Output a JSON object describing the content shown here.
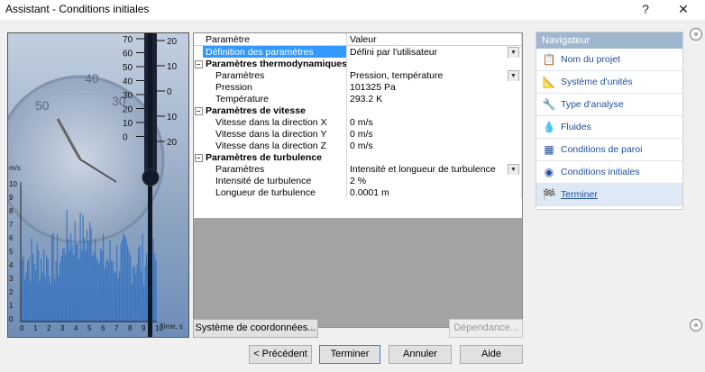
{
  "window": {
    "title": "Assistant - Conditions initiales",
    "help_label": "?",
    "close_label": "✕"
  },
  "illustration": {
    "left_scale": [
      "70",
      "60",
      "50",
      "40",
      "30",
      "20",
      "10",
      "0"
    ],
    "right_scale": [
      "20",
      "10",
      "0",
      "10",
      "20"
    ],
    "chart_y_labels": [
      "10",
      "9",
      "8",
      "7",
      "6",
      "5",
      "4",
      "3",
      "2",
      "1",
      "0"
    ],
    "chart_x_labels": [
      "0",
      "1",
      "2",
      "3",
      "4",
      "5",
      "6",
      "7",
      "8",
      "9",
      "10"
    ],
    "chart_y_unit": "m/s",
    "chart_x_unit": "Time, s",
    "gauge_numbers": [
      "50",
      "40",
      "30"
    ]
  },
  "table": {
    "header": {
      "param": "Paramètre",
      "value": "Valeur"
    },
    "rows": [
      {
        "kind": "sel",
        "indent": false,
        "expander": "",
        "label": "Définition des paramètres",
        "value": "Défini par l'utilisateur",
        "dropdown": true
      },
      {
        "kind": "sec",
        "indent": false,
        "expander": "−",
        "label": "Paramètres thermodynamiques",
        "value": "",
        "dropdown": false
      },
      {
        "kind": "row",
        "indent": true,
        "expander": "",
        "label": "Paramètres",
        "value": "Pression, température",
        "dropdown": true
      },
      {
        "kind": "row",
        "indent": true,
        "expander": "",
        "label": "Pression",
        "value": "101325 Pa",
        "dropdown": false
      },
      {
        "kind": "row",
        "indent": true,
        "expander": "",
        "label": "Température",
        "value": "293.2 K",
        "dropdown": false
      },
      {
        "kind": "sec",
        "indent": false,
        "expander": "−",
        "label": "Paramètres de vitesse",
        "value": "",
        "dropdown": false
      },
      {
        "kind": "row",
        "indent": true,
        "expander": "",
        "label": "Vitesse dans la direction X",
        "value": "0 m/s",
        "dropdown": false
      },
      {
        "kind": "row",
        "indent": true,
        "expander": "",
        "label": "Vitesse dans la direction Y",
        "value": "0 m/s",
        "dropdown": false
      },
      {
        "kind": "row",
        "indent": true,
        "expander": "",
        "label": "Vitesse dans la direction Z",
        "value": "0 m/s",
        "dropdown": false
      },
      {
        "kind": "sec",
        "indent": false,
        "expander": "−",
        "label": "Paramètres de turbulence",
        "value": "",
        "dropdown": false
      },
      {
        "kind": "row",
        "indent": true,
        "expander": "",
        "label": "Paramètres",
        "value": "Intensité et longueur de turbulence",
        "dropdown": true
      },
      {
        "kind": "row",
        "indent": true,
        "expander": "",
        "label": "Intensité de turbulence",
        "value": "2 %",
        "dropdown": false
      },
      {
        "kind": "row",
        "indent": true,
        "expander": "",
        "label": "Longueur de turbulence",
        "value": "0.0001 m",
        "dropdown": false
      }
    ]
  },
  "buttons": {
    "coord": "Système de coordonnées...",
    "dependence": "Dépendance...",
    "previous": "< Précédent",
    "finish": "Terminer",
    "cancel": "Annuler",
    "help": "Aide"
  },
  "navigator": {
    "title": "Navigateur",
    "items": [
      {
        "label": "Nom du projet",
        "icon": "project-name-icon",
        "glyph": "📋",
        "active": false
      },
      {
        "label": "Système d'unités",
        "icon": "unit-system-icon",
        "glyph": "📐",
        "active": false
      },
      {
        "label": "Type d'analyse",
        "icon": "analysis-type-icon",
        "glyph": "🔧",
        "active": false
      },
      {
        "label": "Fluides",
        "icon": "fluids-icon",
        "glyph": "💧",
        "active": false
      },
      {
        "label": "Conditions de paroi",
        "icon": "wall-conditions-icon",
        "glyph": "▦",
        "active": false
      },
      {
        "label": "Conditions initiales",
        "icon": "initial-conditions-icon",
        "glyph": "◉",
        "active": false
      },
      {
        "label": "Terminer",
        "icon": "finish-flag-icon",
        "glyph": "🏁",
        "active": true
      }
    ],
    "collapse_glyph": "«"
  }
}
